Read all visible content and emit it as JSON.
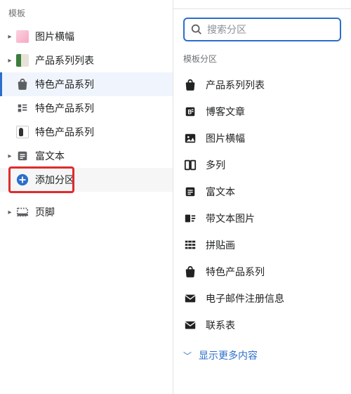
{
  "left": {
    "header": "模板",
    "items": [
      {
        "label": "图片横幅",
        "icon": "thumb-pink",
        "expandable": true
      },
      {
        "label": "产品系列列表",
        "icon": "thumb-green",
        "expandable": true
      },
      {
        "label": "特色产品系列",
        "icon": "bag",
        "selected": true,
        "child": true
      },
      {
        "label": "特色产品系列",
        "icon": "collection",
        "child": true
      },
      {
        "label": "特色产品系列",
        "icon": "thumb-bw",
        "child": true
      },
      {
        "label": "富文本",
        "icon": "richtext",
        "expandable": true
      },
      {
        "label": "添加分区",
        "icon": "add",
        "add": true
      }
    ],
    "footer": {
      "label": "页脚",
      "expandable": true
    }
  },
  "right": {
    "search_placeholder": "搜索分区",
    "section_label": "模板分区",
    "sections": [
      {
        "label": "产品系列列表",
        "icon": "bag"
      },
      {
        "label": "博客文章",
        "icon": "blog"
      },
      {
        "label": "图片横幅",
        "icon": "image"
      },
      {
        "label": "多列",
        "icon": "columns"
      },
      {
        "label": "富文本",
        "icon": "richtext"
      },
      {
        "label": "带文本图片",
        "icon": "image-text"
      },
      {
        "label": "拼贴画",
        "icon": "collage"
      },
      {
        "label": "特色产品系列",
        "icon": "bag"
      },
      {
        "label": "电子邮件注册信息",
        "icon": "mail"
      },
      {
        "label": "联系表",
        "icon": "mail"
      }
    ],
    "show_more": "显示更多内容"
  }
}
